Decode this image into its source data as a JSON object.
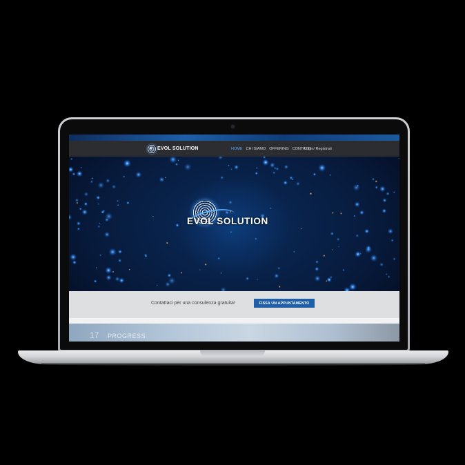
{
  "navbar": {
    "logo_text": "EVOL SOLUTION",
    "items": [
      {
        "label": "HOME",
        "active": true
      },
      {
        "label": "CHI SIAMO",
        "active": false
      },
      {
        "label": "OFFERING",
        "active": false
      },
      {
        "label": "CONTATTI",
        "active": false
      }
    ],
    "login_label": "Login/ Registrati"
  },
  "hero": {
    "logo_text": "EVOL SOLUTION"
  },
  "cta": {
    "text": "Contattaci per una consulenza gratuita!",
    "button_label": "FISSA UN APPUNTAMENTO"
  },
  "progress_section": {
    "number": "17",
    "label": "PROGRESS"
  },
  "colors": {
    "accent": "#1f5ea8",
    "nav_active": "#5aa9ff",
    "navbar_bg": "#2b2d30",
    "cta_bg": "#dedfe1"
  }
}
